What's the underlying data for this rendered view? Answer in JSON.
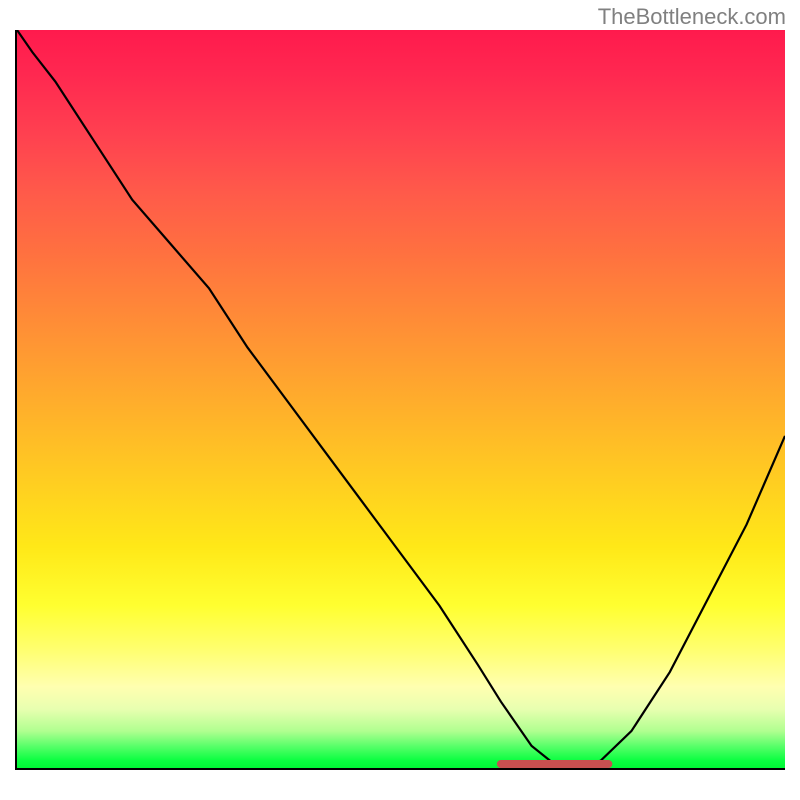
{
  "watermark": "TheBottleneck.com",
  "chart_data": {
    "type": "line",
    "title": "",
    "xlabel": "",
    "ylabel": "",
    "xlim": [
      0,
      100
    ],
    "ylim": [
      0,
      100
    ],
    "series": [
      {
        "name": "curve",
        "x": [
          0,
          2,
          5,
          10,
          15,
          20,
          25,
          30,
          35,
          40,
          45,
          50,
          55,
          60,
          63,
          65,
          67,
          70,
          73,
          76,
          80,
          85,
          90,
          95,
          100
        ],
        "y": [
          100,
          97,
          93,
          85,
          77,
          71,
          65,
          57,
          50,
          43,
          36,
          29,
          22,
          14,
          9,
          6,
          3,
          0.5,
          0,
          1,
          5,
          13,
          23,
          33,
          45
        ]
      }
    ],
    "highlight": {
      "x_start": 63,
      "x_end": 77,
      "y": 0
    }
  },
  "colors": {
    "axis": "#000000",
    "curve": "#000000",
    "marker": "#c85050",
    "watermark": "#808080"
  }
}
